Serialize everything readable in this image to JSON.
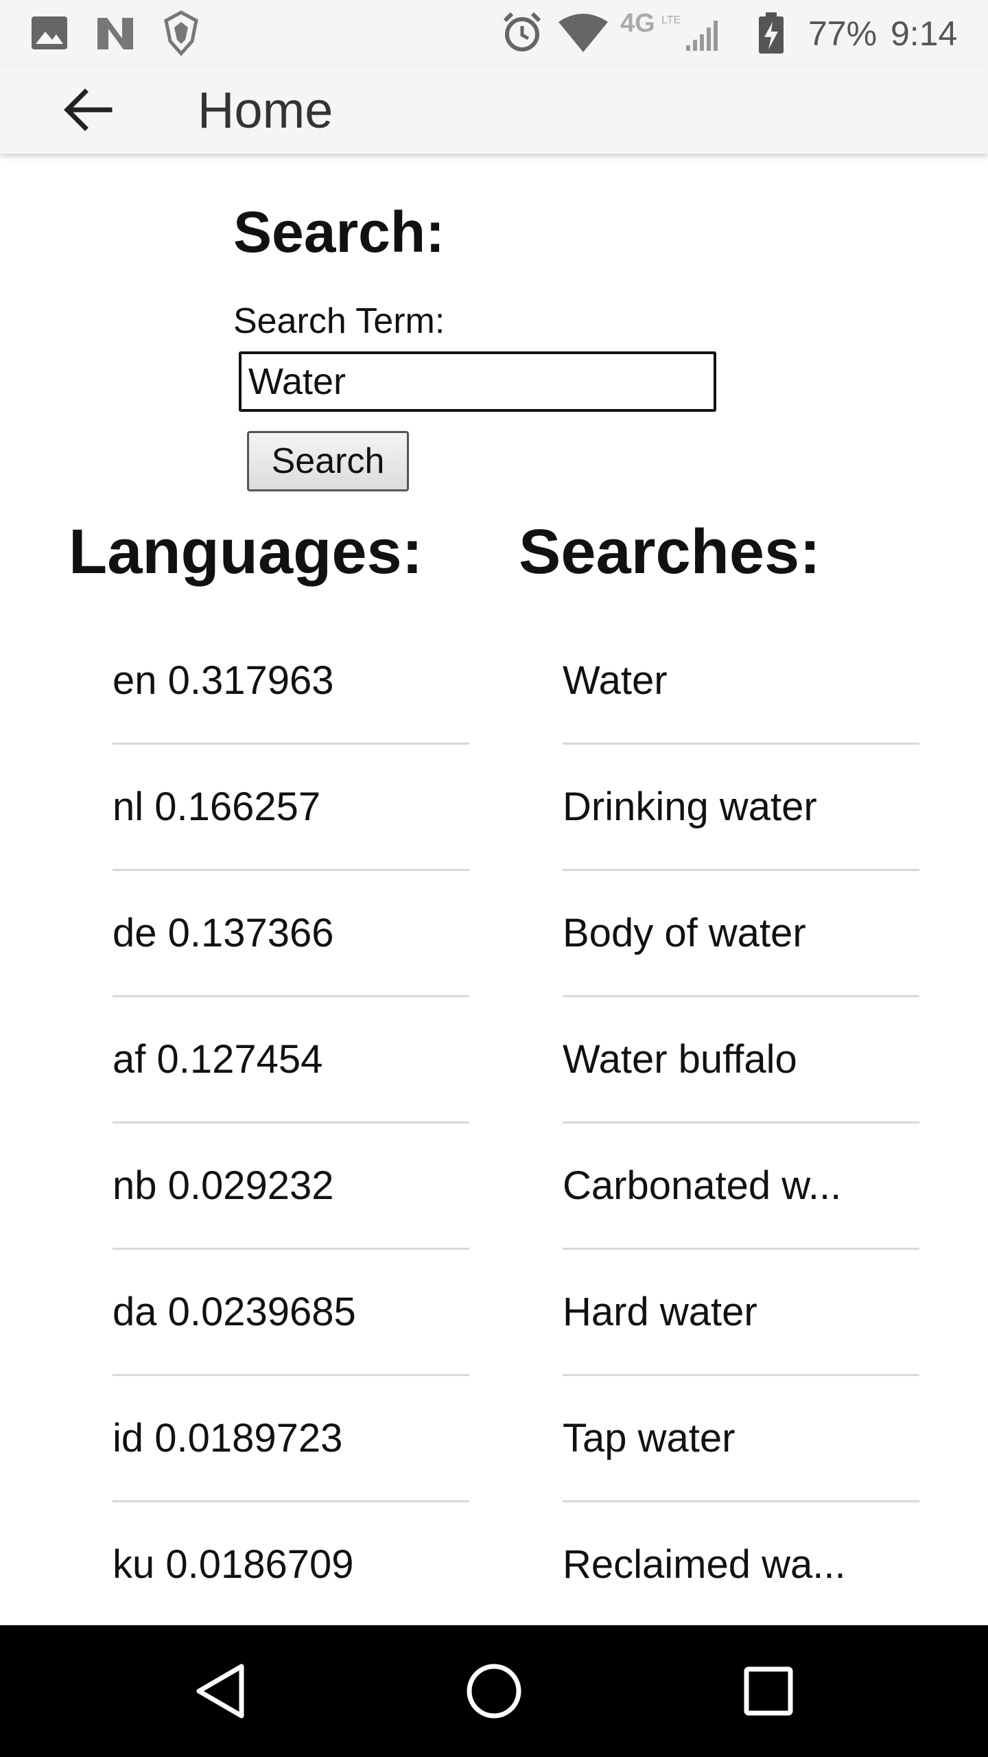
{
  "status_bar": {
    "icons": [
      "image-icon",
      "n-icon",
      "shield-app-icon",
      "alarm-icon",
      "wifi-icon",
      "lte-icon",
      "signal-icon",
      "battery-charging-icon"
    ],
    "network": "4G LTE",
    "battery": "77%",
    "time": "9:14"
  },
  "app_bar": {
    "title": "Home",
    "back_icon": "arrow-back-icon"
  },
  "search": {
    "heading": "Search:",
    "label": "Search Term:",
    "value": "Water",
    "button_label": "Search"
  },
  "languages": {
    "heading": "Languages:",
    "items": [
      "en 0.317963",
      "nl 0.166257",
      "de 0.137366",
      "af 0.127454",
      "nb 0.029232",
      "da 0.0239685",
      "id 0.0189723",
      "ku 0.0186709"
    ]
  },
  "searches": {
    "heading": "Searches:",
    "items": [
      "Water",
      "Drinking water",
      "Body of water",
      "Water buffalo",
      "Carbonated w...",
      "Hard water",
      "Tap water",
      "Reclaimed wa..."
    ]
  },
  "nav_bar": {
    "buttons": [
      "back-triangle-icon",
      "home-circle-icon",
      "recents-square-icon"
    ]
  }
}
